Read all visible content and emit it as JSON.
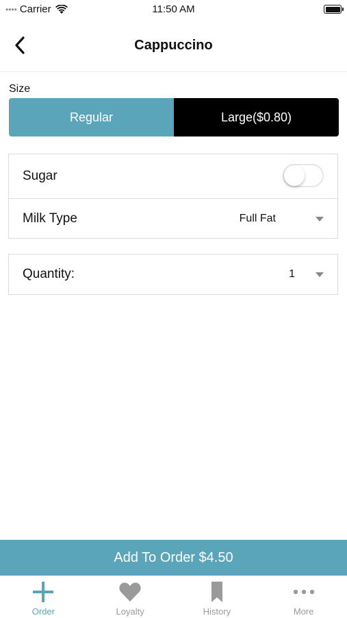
{
  "status_bar": {
    "carrier": "Carrier",
    "time": "11:50 AM"
  },
  "nav": {
    "title": "Cappuccino"
  },
  "size": {
    "label": "Size",
    "options": [
      {
        "label": "Regular",
        "selected": true
      },
      {
        "label": "Large($0.80)",
        "selected": false
      }
    ]
  },
  "options": {
    "sugar": {
      "label": "Sugar",
      "enabled": false
    },
    "milk": {
      "label": "Milk Type",
      "value": "Full Fat"
    },
    "quantity": {
      "label": "Quantity:",
      "value": "1"
    }
  },
  "add_button": {
    "label": "Add To Order $4.50"
  },
  "tabs": [
    {
      "label": "Order",
      "icon": "plus-icon",
      "active": true
    },
    {
      "label": "Loyalty",
      "icon": "heart-icon",
      "active": false
    },
    {
      "label": "History",
      "icon": "bookmark-icon",
      "active": false
    },
    {
      "label": "More",
      "icon": "more-dots-icon",
      "active": false
    }
  ],
  "colors": {
    "accent": "#5ba5bb",
    "inactive_segment": "#000000",
    "tab_inactive": "#9a9a9a"
  }
}
